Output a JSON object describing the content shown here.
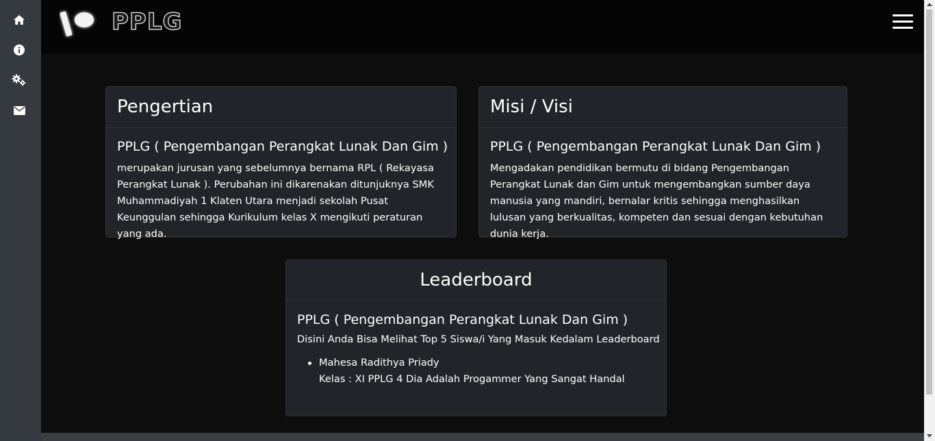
{
  "sidebar": {
    "icons": [
      "home-icon",
      "info-icon",
      "settings-icon",
      "mail-icon"
    ]
  },
  "header": {
    "brand": "PPLG",
    "menu_icon": "hamburger-icon"
  },
  "cards": {
    "pengertian": {
      "title": "Pengertian",
      "subtitle": "PPLG ( Pengembangan Perangkat Lunak Dan Gim )",
      "text": "merupakan jurusan yang sebelumnya bernama RPL ( Rekayasa Perangkat Lunak ). Perubahan ini dikarenakan ditunjuknya SMK Muhammadiyah 1 Klaten Utara menjadi sekolah Pusat Keunggulan sehingga Kurikulum kelas X mengikuti peraturan yang ada."
    },
    "misi": {
      "title": "Misi / Visi",
      "subtitle": "PPLG ( Pengembangan Perangkat Lunak Dan Gim )",
      "text": "Mengadakan pendidikan bermutu di bidang Pengembangan Perangkat Lunak dan Gim untuk mengembangkan sumber daya manusia yang mandiri, bernalar kritis sehingga menghasilkan lulusan yang berkualitas, kompeten dan sesuai dengan kebutuhan dunia kerja."
    },
    "leaderboard": {
      "title": "Leaderboard",
      "subtitle": "PPLG ( Pengembangan Perangkat Lunak Dan Gim )",
      "intro": "Disini Anda Bisa Melihat Top 5 Siswa/i Yang Masuk Kedalam Leaderboard",
      "entries": [
        {
          "name": "Mahesa Radithya Priady",
          "detail": "Kelas : XI PPLG 4 Dia Adalah Progammer Yang Sangat Handal"
        }
      ]
    }
  }
}
